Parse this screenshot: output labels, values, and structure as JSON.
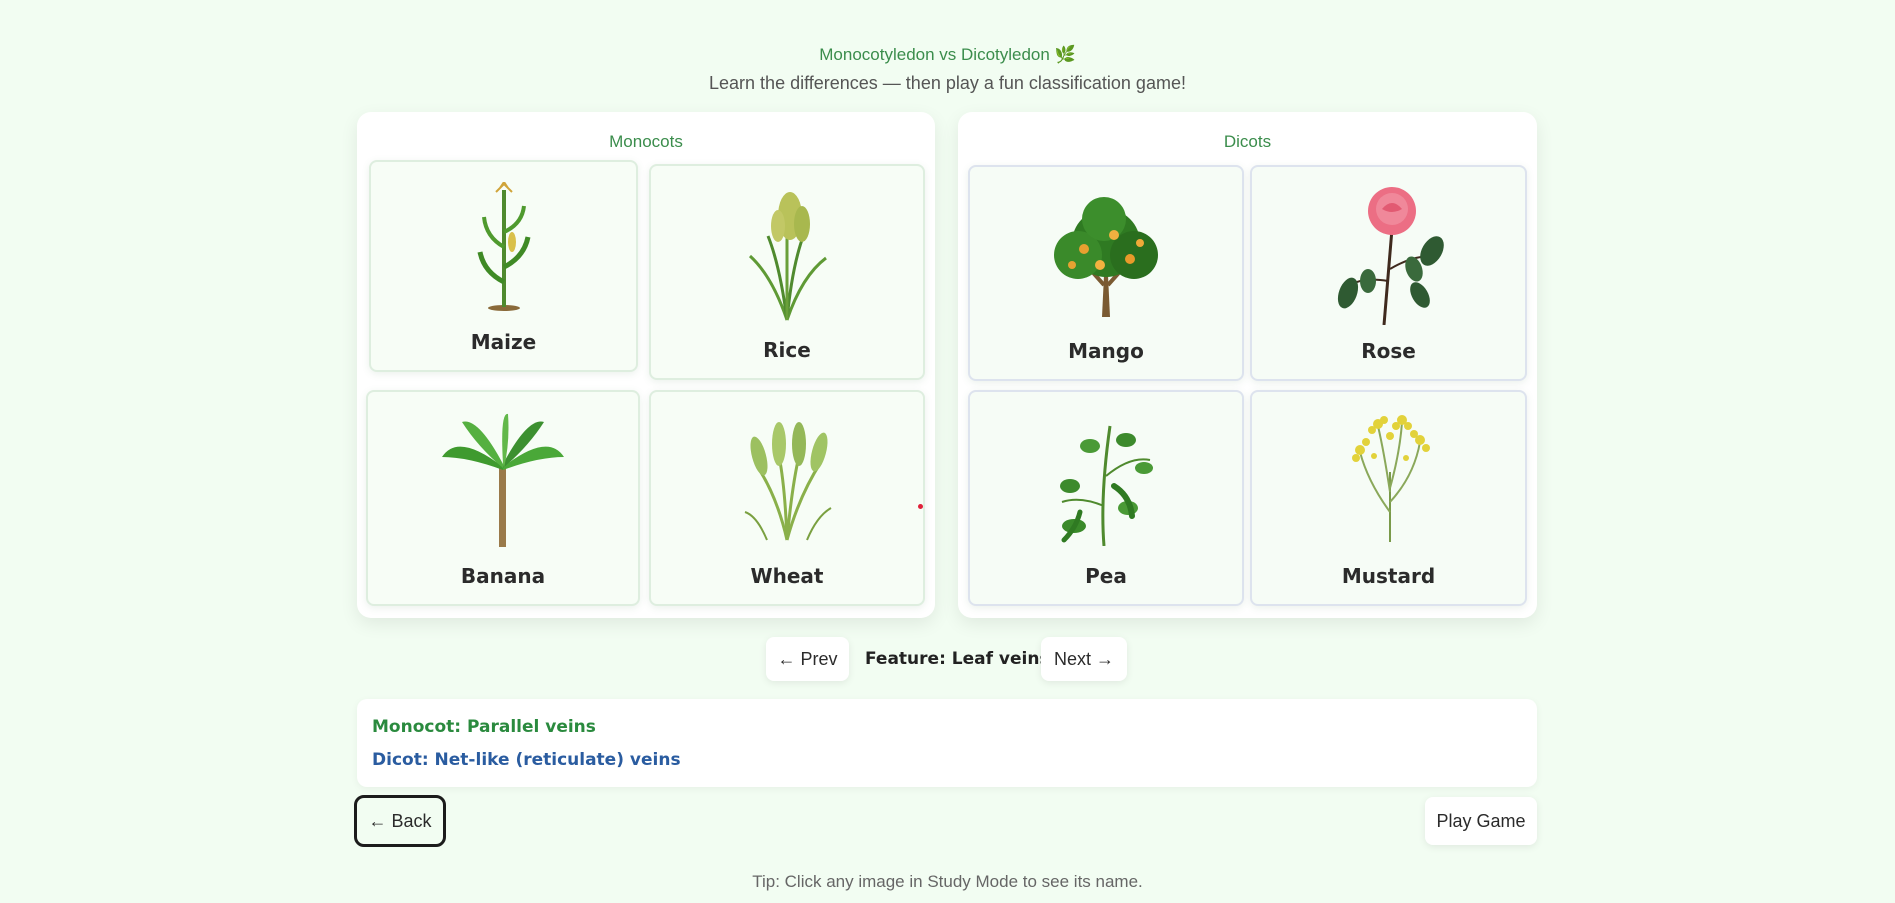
{
  "header": {
    "title": "Monocotyledon vs Dicotyledon 🌿",
    "subtitle": "Learn the differences — then play a fun classification game!"
  },
  "monocots": {
    "title": "Monocots",
    "cards": [
      {
        "label": "Maize",
        "icon": "maize-plant-icon"
      },
      {
        "label": "Rice",
        "icon": "rice-plant-icon"
      },
      {
        "label": "Banana",
        "icon": "banana-plant-icon"
      },
      {
        "label": "Wheat",
        "icon": "wheat-plant-icon"
      }
    ]
  },
  "dicots": {
    "title": "Dicots",
    "cards": [
      {
        "label": "Mango",
        "icon": "mango-tree-icon"
      },
      {
        "label": "Rose",
        "icon": "rose-flower-icon"
      },
      {
        "label": "Pea",
        "icon": "pea-plant-icon"
      },
      {
        "label": "Mustard",
        "icon": "mustard-plant-icon"
      }
    ]
  },
  "nav": {
    "prev_label": "← Prev",
    "feature_label": "Feature: Leaf veins",
    "next_label": "Next →"
  },
  "info": {
    "monocot_key": "Monocot:",
    "monocot_value": "Parallel veins",
    "dicot_key": "Dicot:",
    "dicot_value": "Net-like (reticulate) veins"
  },
  "actions": {
    "back_label": "← Back",
    "play_label": "Play Game"
  },
  "tip": "Tip: Click any image in Study Mode to see its name.",
  "colors": {
    "background": "#f2fdf2",
    "accent_green": "#3b8d4c",
    "monocot_text": "#2a8a3e",
    "dicot_text": "#2a5ca0"
  }
}
